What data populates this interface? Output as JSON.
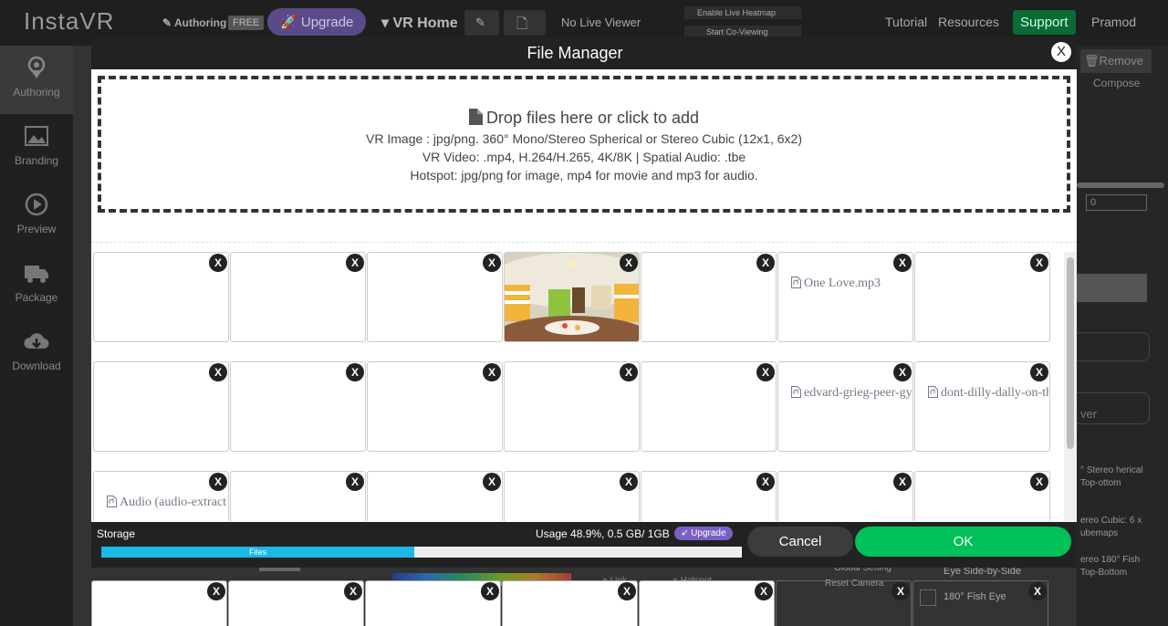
{
  "topbar": {
    "logo": "InstaVR",
    "authoring": "Authoring",
    "free_badge": "FREE",
    "upgrade": "Upgrade",
    "project": "VR Home",
    "no_live_viewer": "No Live Viewer",
    "enable_heatmap": "Enable Live Heatmap",
    "start_coviewing": "Start Co-Viewing",
    "tutorial": "Tutorial",
    "resources": "Resources",
    "support": "Support",
    "user": "Pramod"
  },
  "sidebar": {
    "items": [
      {
        "label": "Authoring",
        "icon": "map-pin-icon",
        "active": true
      },
      {
        "label": "Branding",
        "icon": "image-icon",
        "active": false
      },
      {
        "label": "Preview",
        "icon": "play-icon",
        "active": false
      },
      {
        "label": "Package",
        "icon": "truck-icon",
        "active": false
      },
      {
        "label": "Download",
        "icon": "cloud-download-icon",
        "active": false
      }
    ]
  },
  "background": {
    "remove": "Remove",
    "compose": "Compose",
    "field_value": "0",
    "global_setting": "Global Setting",
    "reset_camera": "Reset Camera",
    "fish_eye": "180° Fish Eye",
    "eye_sbs": "Eye Side-by-Side",
    "stereo_top": "° Stereo herical Top-ottom",
    "stereo_cubic": "ereo Cubic: 6 x ubemaps",
    "stereo_fish": "ereo 180° Fish Top-Bottom",
    "link": "+ Link",
    "hotspot": "+ Hotspot",
    "ver": "ver"
  },
  "modal": {
    "title": "File Manager",
    "close": "X",
    "dropzone": {
      "title": "Drop files here or click to add",
      "line1": "VR Image : jpg/png. 360° Mono/Stereo Spherical or Stereo Cubic (12x1, 6x2)",
      "line2": "VR Video: .mp4, H.264/H.265, 4K/8K | Spatial Audio: .tbe",
      "line3": "Hotspot: jpg/png for image, mp4 for movie and mp3 for audio."
    },
    "files": [
      {
        "name": "",
        "type": "blank"
      },
      {
        "name": "",
        "type": "blank"
      },
      {
        "name": "",
        "type": "blank"
      },
      {
        "name": "",
        "type": "image"
      },
      {
        "name": "",
        "type": "blank"
      },
      {
        "name": "One Love.mp3",
        "type": "audio"
      },
      {
        "name": "",
        "type": "blank"
      },
      {
        "name": "",
        "type": "blank"
      },
      {
        "name": "",
        "type": "blank"
      },
      {
        "name": "",
        "type": "blank"
      },
      {
        "name": "",
        "type": "blank"
      },
      {
        "name": "",
        "type": "blank"
      },
      {
        "name": "edvard-grieg-peer-gynt",
        "type": "audio"
      },
      {
        "name": "dont-dilly-dally-on-the",
        "type": "audio"
      },
      {
        "name": "Audio (audio-extract",
        "type": "audio"
      },
      {
        "name": "",
        "type": "blank"
      },
      {
        "name": "",
        "type": "blank"
      },
      {
        "name": "",
        "type": "blank"
      },
      {
        "name": "",
        "type": "blank"
      },
      {
        "name": "",
        "type": "blank"
      },
      {
        "name": "",
        "type": "blank"
      }
    ],
    "remove_label": "X",
    "footer": {
      "storage_label": "Storage",
      "usage": "Usage 48.9%, 0.5 GB/ 1GB",
      "upgrade": "Upgrade",
      "bar_label": "Files",
      "bar_percent": 48.9,
      "cancel": "Cancel",
      "ok": "OK"
    }
  },
  "colors": {
    "ok": "#00c15a",
    "bar": "#1ab8e6",
    "upgrade": "#7b5fc7",
    "header": "#222222"
  }
}
